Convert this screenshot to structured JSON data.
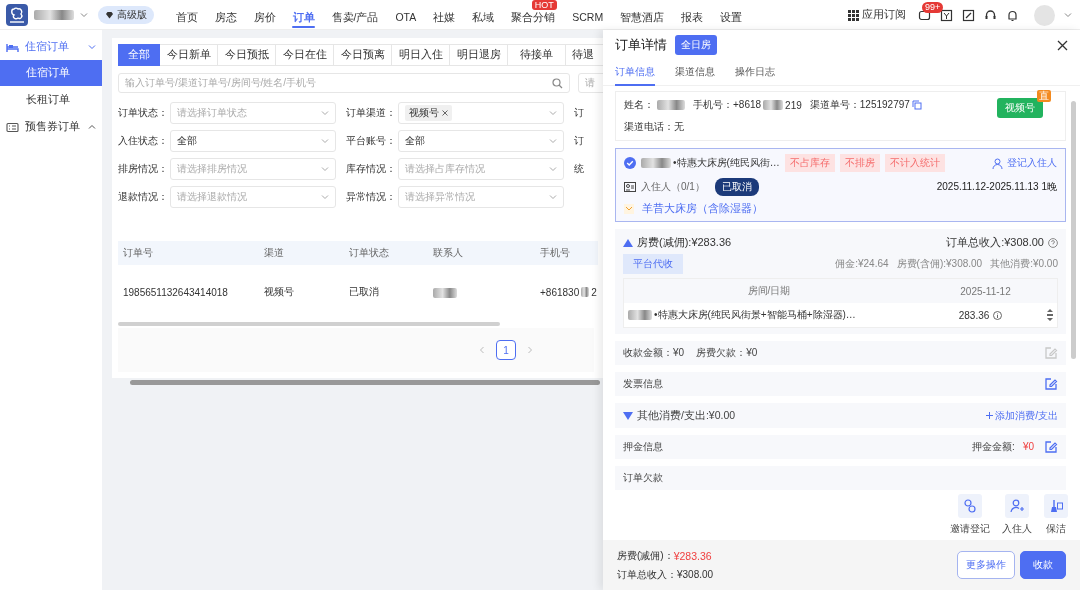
{
  "topbar": {
    "plan_badge": "高级版",
    "nav": [
      {
        "label": "首页",
        "selected": false
      },
      {
        "label": "房态",
        "selected": false
      },
      {
        "label": "房价",
        "selected": false
      },
      {
        "label": "订单",
        "selected": true
      },
      {
        "label": "售卖/产品",
        "selected": false
      },
      {
        "label": "OTA",
        "selected": false
      },
      {
        "label": "社媒",
        "selected": false
      },
      {
        "label": "私域",
        "selected": false
      },
      {
        "label": "聚合分销",
        "selected": false,
        "badge": "HOT"
      },
      {
        "label": "SCRM",
        "selected": false
      },
      {
        "label": "智慧酒店",
        "selected": false
      },
      {
        "label": "报表",
        "selected": false
      },
      {
        "label": "设置",
        "selected": false
      }
    ],
    "apps": "应用订阅",
    "message_count": "99+"
  },
  "sidebar": {
    "groups": [
      {
        "label": "住宿订单",
        "expanded": true,
        "children": [
          {
            "label": "住宿订单",
            "selected": true
          },
          {
            "label": "长租订单",
            "selected": false
          }
        ]
      },
      {
        "label": "预售券订单",
        "expanded": false
      }
    ]
  },
  "orders": {
    "tabs": [
      {
        "label": "全部",
        "selected": true
      },
      {
        "label": "今日新单",
        "selected": false
      },
      {
        "label": "今日预抵",
        "selected": false
      },
      {
        "label": "今日在住",
        "selected": false
      },
      {
        "label": "今日预离",
        "selected": false
      },
      {
        "label": "明日入住",
        "selected": false
      },
      {
        "label": "明日退房",
        "selected": false
      },
      {
        "label": "待接单",
        "selected": false
      },
      {
        "label": "待退",
        "selected": false
      }
    ],
    "search": {
      "placeholder": "输入订单号/渠道订单号/房间号/姓名/手机号"
    },
    "search_2": {
      "placeholder": "请"
    },
    "filters": [
      {
        "fields": [
          {
            "label": "订单状态：",
            "kind": "select",
            "placeholder": "请选择订单状态"
          },
          {
            "label": "订单渠道：",
            "kind": "tags",
            "tags": [
              "视频号"
            ]
          }
        ],
        "cut_label": "订"
      },
      {
        "fields": [
          {
            "label": "入住状态：",
            "kind": "select",
            "value": "全部"
          },
          {
            "label": "平台账号：",
            "kind": "select",
            "value": "全部"
          }
        ],
        "cut_label": "订"
      },
      {
        "fields": [
          {
            "label": "排房情况：",
            "kind": "select",
            "placeholder": "请选择排房情况"
          },
          {
            "label": "库存情况：",
            "kind": "select",
            "placeholder": "请选择占库存情况"
          }
        ],
        "cut_label": "统"
      },
      {
        "fields": [
          {
            "label": "退款情况：",
            "kind": "select",
            "placeholder": "请选择退款情况"
          },
          {
            "label": "异常情况：",
            "kind": "select",
            "placeholder": "请选择异常情况"
          }
        ]
      }
    ],
    "table": {
      "columns": [
        "订单号",
        "渠道",
        "订单状态",
        "联系人",
        "手机号"
      ],
      "rows": [
        {
          "cells": [
            {
              "kind": "text",
              "text": "1985651132643414018"
            },
            {
              "kind": "text",
              "text": "视频号"
            },
            {
              "kind": "text",
              "text": "已取消"
            },
            {
              "kind": "blurred"
            },
            {
              "kind": "partial",
              "before": "+861830",
              "after": "2"
            }
          ]
        }
      ]
    },
    "pagination": {
      "pages": [
        {
          "label": "1",
          "selected": true
        }
      ]
    }
  },
  "drawer": {
    "title": "订单详情",
    "type_badge": "全日房",
    "tabs": [
      {
        "label": "订单信息",
        "selected": true
      },
      {
        "label": "渠道信息",
        "selected": false
      },
      {
        "label": "操作日志",
        "selected": false
      }
    ],
    "guest": {
      "name_label": "姓名：",
      "phone_label": "手机号：+8618",
      "phone_end": "219",
      "channel_no": "渠道单号：125192797",
      "channel_badge": "视频号",
      "corner_badge": "直",
      "channel_phone": "渠道电话：无"
    },
    "room": {
      "checked": true,
      "name": "•特惠大床房(纯民风街…",
      "tags": [
        "不占库存",
        "不排房",
        "不计入统计"
      ],
      "register": "登记入住人",
      "guests": "入住人（0/1）",
      "status": "已取消",
      "dates": "2025.11.12-2025.11.13 1晚",
      "product": "羊昔大床房（含除湿器）"
    },
    "fees": {
      "expanded": true,
      "title": "房费(减佣):¥283.36",
      "total": "订单总收入:¥308.00",
      "tag": "平台代收",
      "breakdown": [
        "佣金:¥24.64",
        "房费(含佣):¥308.00",
        "其他消费:¥0.00"
      ],
      "table": {
        "columns": [
          "房间/日期",
          "2025-11-12"
        ],
        "rows": [
          {
            "room": "•特惠大床房(纯民风街景+智能马桶+除湿器)…",
            "amount": "283.36"
          }
        ]
      }
    },
    "sections": [
      {
        "kind": "payment",
        "texts": [
          "收款金额：¥0",
          "房费欠款：¥0"
        ],
        "edit_disabled": true
      },
      {
        "kind": "plain",
        "title": "发票信息",
        "edit_disabled": false
      },
      {
        "kind": "expense",
        "title": "其他消费/支出:¥0.00",
        "expanded": false,
        "action": "添加消费/支出"
      },
      {
        "kind": "deposit",
        "title": "押金信息",
        "amount_label": "押金金额:",
        "amount": "¥0",
        "edit_disabled": false
      },
      {
        "kind": "plain",
        "title": "订单欠款"
      }
    ],
    "actions": [
      {
        "label": "邀请登记"
      },
      {
        "label": "入住人"
      },
      {
        "label": "保洁"
      }
    ],
    "footer": {
      "fee_label": "房费(减佣)：",
      "fee": "¥283.36",
      "total": "订单总收入：¥308.00",
      "buttons": [
        {
          "label": "更多操作",
          "kind": "secondary"
        },
        {
          "label": "收款",
          "kind": "primary"
        }
      ]
    }
  }
}
